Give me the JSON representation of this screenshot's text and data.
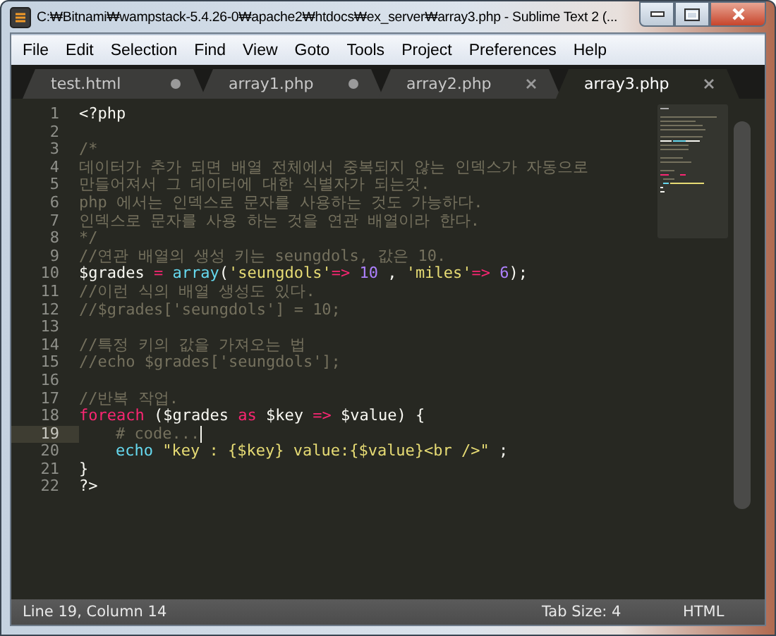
{
  "window": {
    "title": "C:₩Bitnami₩wampstack-5.4.26-0₩apache2₩htdocs₩ex_server₩array3.php - Sublime Text 2 (..."
  },
  "menu": [
    "File",
    "Edit",
    "Selection",
    "Find",
    "View",
    "Goto",
    "Tools",
    "Project",
    "Preferences",
    "Help"
  ],
  "tabs": [
    {
      "label": "test.html",
      "selected": false,
      "modified": true
    },
    {
      "label": "array1.php",
      "selected": false,
      "modified": true
    },
    {
      "label": "array2.php",
      "selected": false,
      "modified": false
    },
    {
      "label": "array3.php",
      "selected": true,
      "modified": false
    }
  ],
  "editor": {
    "lines": [
      {
        "number": "1",
        "selected": false,
        "tokens": [
          {
            "kind": "plain",
            "text": "<?php"
          }
        ]
      },
      {
        "number": "2",
        "selected": false
      },
      {
        "number": "3",
        "selected": false,
        "tokens": [
          {
            "kind": "comment",
            "text": "/*"
          }
        ]
      },
      {
        "number": "4",
        "selected": false,
        "tokens": [
          {
            "kind": "comment",
            "text": "데이터가 추가 되면 배열 전체에서 중복되지 않는 인덱스가 자동으로"
          }
        ]
      },
      {
        "number": "5",
        "selected": false,
        "tokens": [
          {
            "kind": "comment",
            "text": "만들어져서 그 데이터에 대한 식별자가 되는것."
          }
        ]
      },
      {
        "number": "6",
        "selected": false,
        "tokens": [
          {
            "kind": "comment",
            "text": "php 에서는 인덱스로 문자를 사용하는 것도 가능하다."
          }
        ]
      },
      {
        "number": "7",
        "selected": false,
        "tokens": [
          {
            "kind": "comment",
            "text": "인덱스로 문자를 사용 하는 것을 연관 배열이라 한다."
          }
        ]
      },
      {
        "number": "8",
        "selected": false,
        "tokens": [
          {
            "kind": "comment",
            "text": "*/"
          }
        ]
      },
      {
        "number": "9",
        "selected": false,
        "tokens": [
          {
            "kind": "comment",
            "text": "//연관 배열의 생성 키는 seungdols, 값은 10."
          }
        ]
      },
      {
        "number": "10",
        "selected": false,
        "tokens": [
          {
            "kind": "plain",
            "text": "$grades "
          },
          {
            "kind": "operator",
            "text": "="
          },
          {
            "kind": "function",
            "text": " array"
          },
          {
            "kind": "plain",
            "text": "("
          },
          {
            "kind": "string",
            "text": "'seungdols'"
          },
          {
            "kind": "operator",
            "text": "=>"
          },
          {
            "kind": "number",
            "text": " 10"
          },
          {
            "kind": "plain",
            "text": " , "
          },
          {
            "kind": "string",
            "text": "'miles'"
          },
          {
            "kind": "operator",
            "text": "=>"
          },
          {
            "kind": "number",
            "text": " 6"
          },
          {
            "kind": "plain",
            "text": ");"
          }
        ]
      },
      {
        "number": "11",
        "selected": false,
        "tokens": [
          {
            "kind": "comment",
            "text": "//이런 식의 배열 생성도 있다."
          }
        ]
      },
      {
        "number": "12",
        "selected": false,
        "tokens": [
          {
            "kind": "comment",
            "text": "//$grades['seungdols'] = 10;"
          }
        ]
      },
      {
        "number": "13",
        "selected": false
      },
      {
        "number": "14",
        "selected": false,
        "tokens": [
          {
            "kind": "comment",
            "text": "//특정 키의 값을 가져오는 법"
          }
        ]
      },
      {
        "number": "15",
        "selected": false,
        "tokens": [
          {
            "kind": "comment",
            "text": "//echo $grades['seungdols'];"
          }
        ]
      },
      {
        "number": "16",
        "selected": false
      },
      {
        "number": "17",
        "selected": false,
        "tokens": [
          {
            "kind": "comment",
            "text": "//반복 작업."
          }
        ]
      },
      {
        "number": "18",
        "selected": false,
        "tokens": [
          {
            "kind": "keyword",
            "text": "foreach"
          },
          {
            "kind": "plain",
            "text": " ($grades "
          },
          {
            "kind": "keyword",
            "text": "as"
          },
          {
            "kind": "plain",
            "text": " $key "
          },
          {
            "kind": "operator",
            "text": "=>"
          },
          {
            "kind": "plain",
            "text": " $value) {"
          }
        ]
      },
      {
        "number": "19",
        "selected": true,
        "indented": true,
        "tokens": [
          {
            "kind": "comment",
            "text": "# code..."
          }
        ]
      },
      {
        "number": "20",
        "selected": false,
        "indented": true,
        "tokens": [
          {
            "kind": "function",
            "text": "echo"
          },
          {
            "kind": "string",
            "text": " \"key : {$key} value:{$value}<br />\""
          },
          {
            "kind": "plain",
            "text": " ;"
          }
        ]
      },
      {
        "number": "21",
        "selected": false,
        "tokens": [
          {
            "kind": "plain",
            "text": "}"
          }
        ]
      },
      {
        "number": "22",
        "selected": false,
        "tokens": [
          {
            "kind": "plain",
            "text": "?>"
          }
        ]
      }
    ]
  },
  "status_bar": {
    "position": "Line 19, Column 14",
    "tab_size": "Tab Size: 4",
    "syntax": "HTML"
  }
}
